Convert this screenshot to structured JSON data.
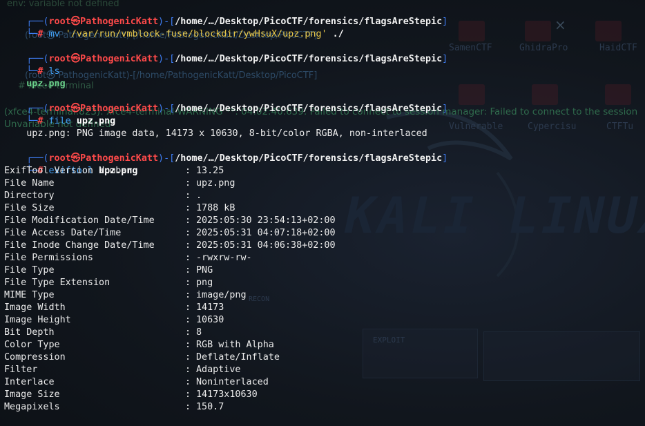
{
  "prompt": {
    "user": "root",
    "skull": "㉿",
    "host": "PathogenicKatt",
    "cwd": "/home/…/Desktop/PicoCTF/forensics/flagsAreStepic",
    "symbol": "#",
    "open": "┌──(",
    "close": ")-[",
    "end": "]",
    "corner": "└─"
  },
  "commands": {
    "mv": {
      "name": "mv",
      "src": "'/var/run/vmblock-fuse/blockdir/ywHsuX/upz.png'",
      "dst": "./"
    },
    "ls": {
      "name": "ls",
      "output": "upz.png"
    },
    "file": {
      "name": "file",
      "arg": "upz.png",
      "output": "upz.png: PNG image data, 14173 x 10630, 8-bit/color RGBA, non-interlaced"
    },
    "exiftool": {
      "name": "exiftool",
      "arg": "upz.png"
    }
  },
  "exif": [
    {
      "key": "ExifTool Version Number",
      "value": "13.25"
    },
    {
      "key": "File Name",
      "value": "upz.png"
    },
    {
      "key": "Directory",
      "value": "."
    },
    {
      "key": "File Size",
      "value": "1788 kB"
    },
    {
      "key": "File Modification Date/Time",
      "value": "2025:05:30 23:54:13+02:00"
    },
    {
      "key": "File Access Date/Time",
      "value": "2025:05:31 04:07:18+02:00"
    },
    {
      "key": "File Inode Change Date/Time",
      "value": "2025:05:31 04:06:38+02:00"
    },
    {
      "key": "File Permissions",
      "value": "-rwxrw-rw-"
    },
    {
      "key": "File Type",
      "value": "PNG"
    },
    {
      "key": "File Type Extension",
      "value": "png"
    },
    {
      "key": "MIME Type",
      "value": "image/png"
    },
    {
      "key": "Image Width",
      "value": "14173"
    },
    {
      "key": "Image Height",
      "value": "10630"
    },
    {
      "key": "Bit Depth",
      "value": "8"
    },
    {
      "key": "Color Type",
      "value": "RGB with Alpha"
    },
    {
      "key": "Compression",
      "value": "Deflate/Inflate"
    },
    {
      "key": "Filter",
      "value": "Adaptive"
    },
    {
      "key": "Interlace",
      "value": "Noninterlaced"
    },
    {
      "key": "Image Size",
      "value": "14173x10630"
    },
    {
      "key": "Megapixels",
      "value": "150.7"
    }
  ],
  "exif_separator": ":",
  "ghost": {
    "line1": "env: variable not defined",
    "prompt_a": "(root㉿ PathogenicKatt)-[/home/PathogenicKatt/Desktop/PicoCTF]",
    "prompt_b": "(root㉿ PathogenicKatt)-[/home/PathogenicKatt/Desktop/PicoCTF]",
    "xfce": "# xfce4-terminal",
    "warning": "(xfce4-terminal:823): xfce4-terminal-WARNING **: 04:02:40.639: Failed to connect to session manager: Failed to connect to the session",
    "unset": "Unvariable not defined",
    "close_glyph": "×",
    "wall_labels": [
      "SamenCTF",
      "GhidraPro",
      "HaidCTF",
      "Vulnerable",
      "Cypercisu",
      "CTFTu"
    ],
    "wall_logo": "KALI LINUX",
    "wall_exploit": "EXPLOIT",
    "wall_recon": "RECON"
  },
  "colors": {
    "background": "#0f1419",
    "prompt_bracket": "#3f7ef5",
    "prompt_user": "#ff4a4a",
    "command": "#42a0f5",
    "string": "#e8c84a",
    "ghost_green": "#2f5a44"
  }
}
